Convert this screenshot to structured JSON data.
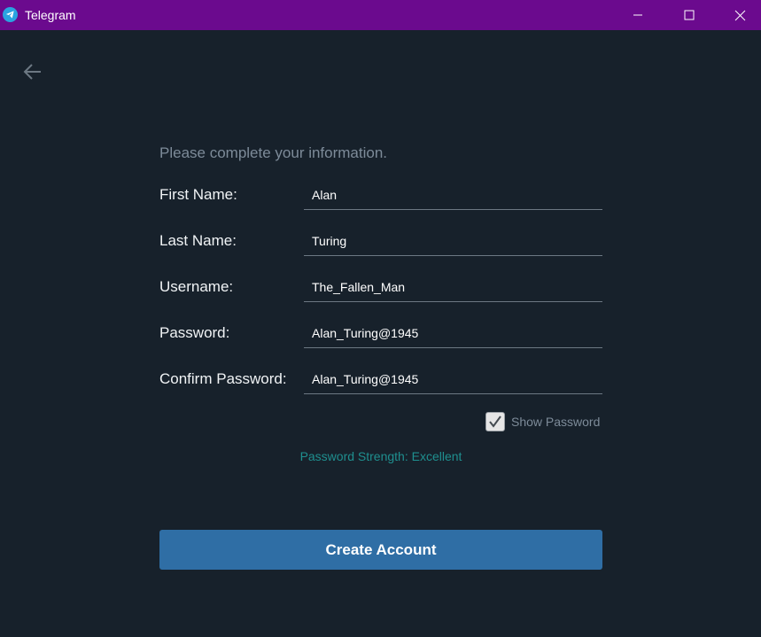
{
  "window": {
    "title": "Telegram",
    "controls": [
      "minimize-icon",
      "maximize-icon",
      "close-icon"
    ]
  },
  "nav": {
    "back_icon": "arrow-left-icon"
  },
  "form": {
    "intro": "Please complete your information.",
    "fields": [
      {
        "label": "First Name:",
        "value": "Alan"
      },
      {
        "label": "Last Name:",
        "value": "Turing"
      },
      {
        "label": "Username:",
        "value": "The_Fallen_Man"
      },
      {
        "label": "Password:",
        "value": "Alan_Turing@1945"
      },
      {
        "label": "Confirm Password:",
        "value": "Alan_Turing@1945"
      }
    ],
    "show_password": {
      "label": "Show Password",
      "checked": true
    },
    "strength": "Password Strength: Excellent",
    "submit_label": "Create Account"
  },
  "colors": {
    "titlebar": "#6b0a8e",
    "background": "#17212b",
    "accent_button": "#2f6ea5",
    "strength_text": "#1f8f8f"
  }
}
